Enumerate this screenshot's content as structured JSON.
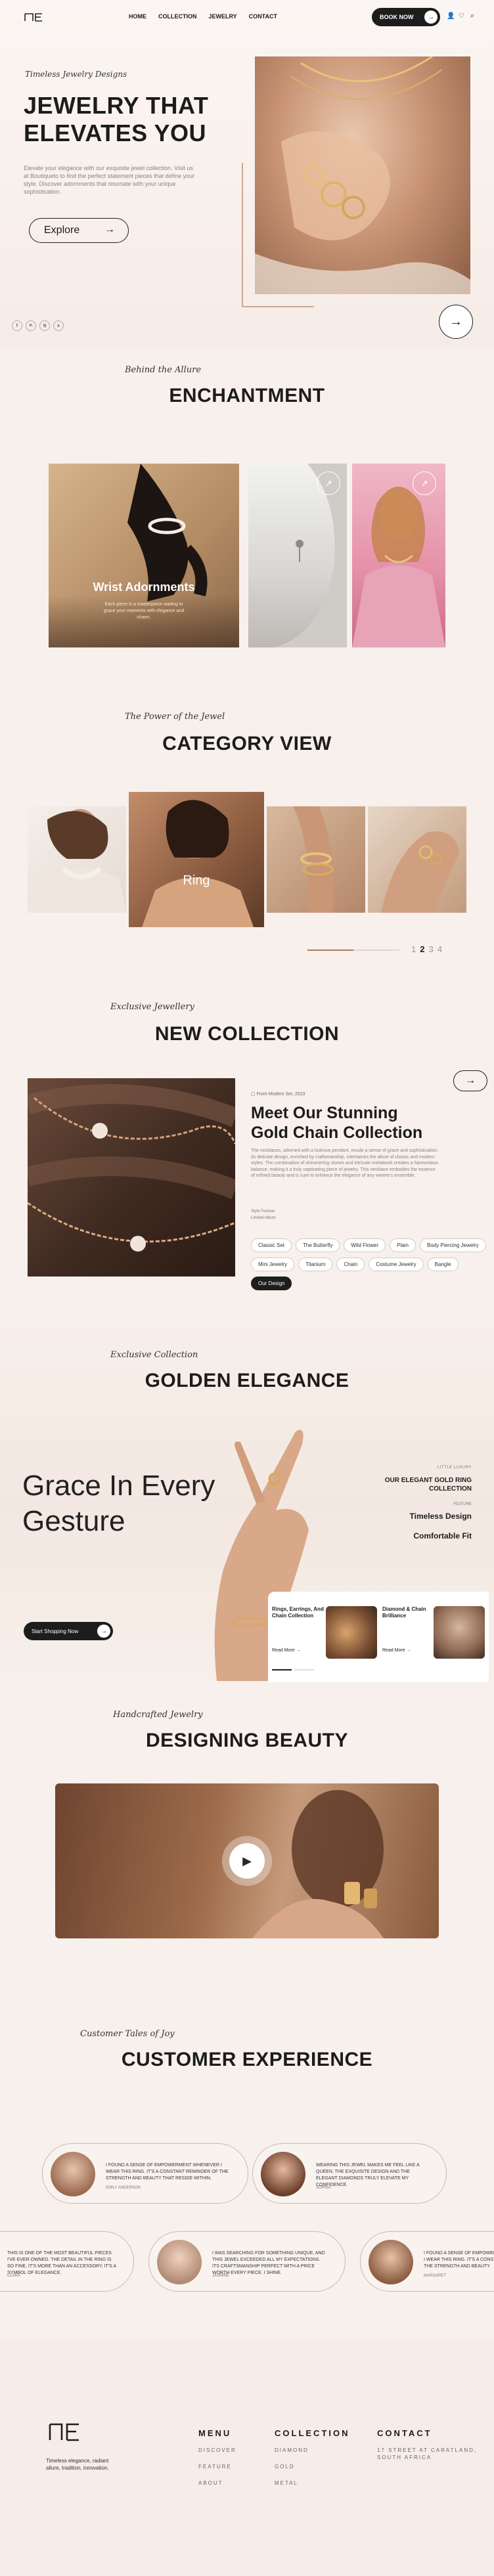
{
  "nav": {
    "links": [
      "HOME",
      "COLLECTION",
      "JEWELRY",
      "CONTACT"
    ],
    "book_now": "BOOK NOW"
  },
  "hero": {
    "eyebrow": "Timeless Jewelry Designs",
    "title_line1": "JEWELRY THAT",
    "title_line2": "ELEVATES YOU",
    "description": "Elevate your elegance with our exquisite jewel collection. Visit us at Boutiqueto to find the perfect statement pieces that define your style. Discover adornments that resonate with your unique sophistication.",
    "explore": "Explore",
    "social": [
      "f",
      "in",
      "ig",
      "x"
    ]
  },
  "enchantment": {
    "eyebrow": "Behind the Allure",
    "title": "ENCHANTMENT",
    "card_title": "Wrist Adornments",
    "card_text": "Each piece is a masterpiece waiting to grace your moments with elegance and charm."
  },
  "category": {
    "eyebrow": "The Power of the Jewel",
    "title": "CATEGORY VIEW",
    "center_label": "Ring",
    "pagination": [
      "1",
      "2",
      "3",
      "4"
    ]
  },
  "new_collection": {
    "eyebrow": "Exclusive Jewellery",
    "title": "NEW COLLECTION",
    "date": "From Modern Set, 2023",
    "heading_line1": "Meet Our Stunning",
    "heading_line2": "Gold Chain Collection",
    "body": "The necklaces, adorned with a lustrous pendant, exude a sense of grace and sophistication. Its delicate design, enriched by craftsmanship, intertwines the allure of classic and modern styles. The combination of shimmering stones and intricate metalwork creates a harmonious balance, making it a truly captivating piece of jewelry. This necklace embodies the essence of refined beauty and is sure to enhance the elegance of any wearer's ensemble.",
    "meta1": "Style Festival",
    "meta2": "Limited Album",
    "tags": [
      "Classic Set",
      "The Butterfly",
      "Wild Flower",
      "Plain",
      "Body Piercing Jewelry",
      "Mini Jewelry",
      "Titanium",
      "Chain",
      "Costume Jewelry",
      "Bangle",
      "Our Design"
    ]
  },
  "golden": {
    "eyebrow": "Exclusive Collection",
    "title": "GOLDEN ELEGANCE",
    "grace_line1": "Grace In Every",
    "grace_line2": "Gesture",
    "shop_btn": "Start Shopping Now",
    "small_label": "LITTLE LUXURY",
    "ring_title": "OUR ELEGANT GOLD RING COLLECTION",
    "feature_label": "FEATURE",
    "feature1": "Timeless Design",
    "feature2": "Comfortable Fit",
    "card1_title": "Rings, Earrings, And Chain Collection",
    "card1_link": "Read More",
    "card2_title": "Diamond & Chain Brilliance",
    "card2_link": "Read More"
  },
  "designing": {
    "eyebrow": "Handcrafted Jewelry",
    "title": "DESIGNING BEAUTY"
  },
  "customer": {
    "eyebrow": "Customer Tales of Joy",
    "title": "CUSTOMER EXPERIENCE",
    "reviews": [
      {
        "text": "I FOUND A SENSE OF EMPOWERMENT WHENEVER I WEAR THIS RING. IT'S A CONSTANT REMINDER OF THE STRENGTH AND BEAUTY THAT RESIDE WITHIN.",
        "name": "EMILY ANDERSON"
      },
      {
        "text": "WEARING THIS JEWEL MAKES ME FEEL LIKE A QUEEN. THE EXQUISITE DESIGN AND THE ELEGANT DIAMONDS TRULY ELEVATE MY CONFIDENCE.",
        "name": "SOPHIA"
      },
      {
        "text": "THIS IS ONE OF THE MOST BEAUTIFUL PIECES I'VE EVER OWNED. THE DETAIL IN THE RING IS SO FINE, IT'S MORE THAN AN ACCESSORY, IT'S A SYMBOL OF ELEGANCE.",
        "name": "CLARA"
      },
      {
        "text": "I WAS SEARCHING FOR SOMETHING UNIQUE, AND THIS JEWEL EXCEEDED ALL MY EXPECTATIONS. ITS CRAFTSMANSHIP PERFECT WITH A PRICE WORTH EVERY PIECE. I SHINE.",
        "name": "JASMINE"
      },
      {
        "text": "I FOUND A SENSE OF EMPOWERMENT WHENEVER I WEAR THIS RING. IT'S A CONSTANT REMINDER OF THE STRENGTH AND BEAUTY.",
        "name": "MARGARET"
      }
    ]
  },
  "footer": {
    "tagline": "Timeless elegance, radiant allure, tradition, innovation.",
    "menu_title": "MENU",
    "menu": [
      "DISCOVER",
      "FEATURE",
      "ABOUT"
    ],
    "collection_title": "COLLECTION",
    "collection": [
      "DIAMOND",
      "GOLD",
      "METAL"
    ],
    "contact_title": "CONTACT",
    "contact": [
      "17 STREET AT CARATLAND,",
      "SOUTH AFRICA"
    ]
  },
  "colors": {
    "accent": "#b07a5a",
    "dark": "#1d1d1d",
    "bg": "#f7f0ec"
  }
}
